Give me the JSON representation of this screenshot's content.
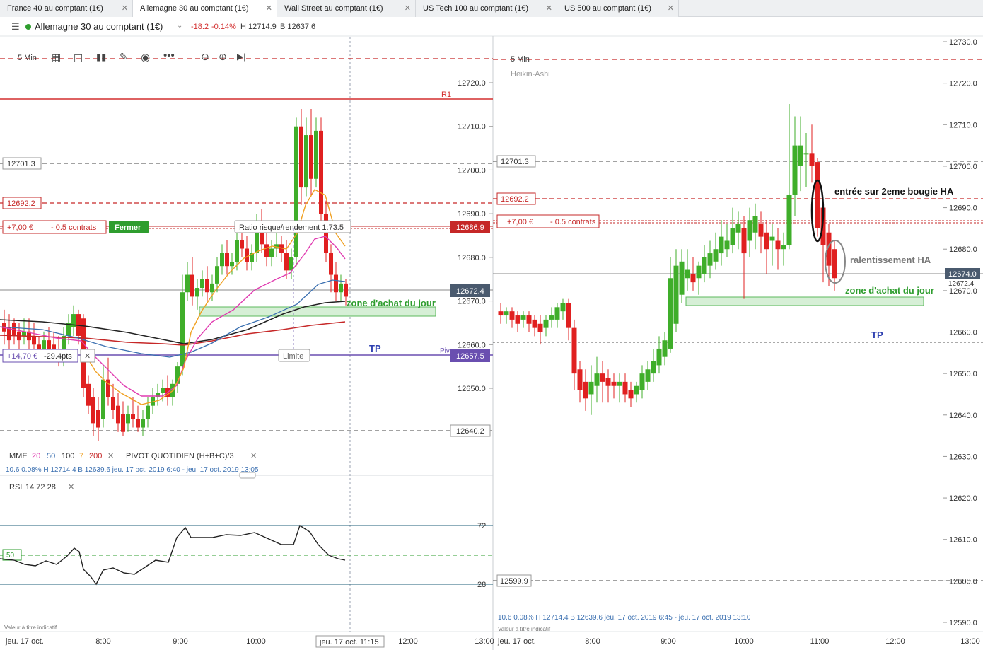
{
  "tabs": [
    {
      "label": "France 40 au comptant (1€)"
    },
    {
      "label": "Allemagne 30 au comptant (1€)"
    },
    {
      "label": "Wall Street au comptant (1€)"
    },
    {
      "label": "US Tech 100 au comptant (1€)"
    },
    {
      "label": "US 500 au comptant (1€)"
    }
  ],
  "active_tab": 1,
  "header": {
    "instrument": "Allemagne 30 au comptant (1€)",
    "change": "-18.2",
    "change_pct": "-0.14%",
    "high": "H 12714.9",
    "low": "B 12637.6"
  },
  "left_chart": {
    "timeframe": "5 Min",
    "price_axis": [
      "12720.0",
      "12710.0",
      "12700.0",
      "12690.0",
      "12680.0",
      "12670.0",
      "12660.0",
      "12650.0"
    ],
    "time_axis": [
      "8:00",
      "9:00",
      "10:00",
      "12:00",
      "13:00"
    ],
    "date_start": "jeu. 17 oct.",
    "crosshair_time": "jeu. 17 oct. 11:15",
    "level_labels": {
      "l12701": "12701.3",
      "l12692": "12692.2",
      "l12640": "12640.2"
    },
    "r1_label": "R1",
    "pivot_label": "Piv",
    "position": {
      "pnl": "+7,00 €",
      "size": "- 0.5 contrats",
      "close_button": "Fermer"
    },
    "ratio_label": "Ratio risque/rendement 1:73.5",
    "target": {
      "pnl": "+14,70 €",
      "pts": "-29.4pts"
    },
    "limit_label": "Limite",
    "badges": {
      "entry": "12686.9",
      "current": "12672.4",
      "limit": "12657.5"
    },
    "indicators": {
      "mme_label": "MME",
      "mme_periods": [
        "20",
        "50",
        "100",
        "7",
        "200"
      ],
      "pivot_label": "PIVOT QUOTIDIEN (H+B+C)/3",
      "stats": "10.6   0.08%   H 12714.4   B 12639.6   jeu. 17 oct. 2019 6:40 - jeu. 17 oct. 2019 13:05"
    },
    "rsi": {
      "label": "RSI",
      "params": [
        "14",
        "72",
        "28"
      ],
      "levels": [
        "72",
        "50",
        "28"
      ]
    },
    "disclaimer": "Valeur à titre indicatif"
  },
  "right_chart": {
    "timeframe": "5 Min",
    "subtitle": "Heikin-Ashi",
    "price_axis": [
      "12730.0",
      "12720.0",
      "12710.0",
      "12700.0",
      "12690.0",
      "12680.0",
      "12670.0",
      "12660.0",
      "12650.0",
      "12640.0",
      "12630.0",
      "12620.0",
      "12610.0",
      "12600.0",
      "12590.0"
    ],
    "time_axis": [
      "8:00",
      "9:00",
      "10:00",
      "11:00",
      "12:00",
      "13:00"
    ],
    "date_start": "jeu. 17 oct.",
    "level_labels": {
      "l12701": "12701.3",
      "l12692": "12692.2",
      "l12599": "12599.9"
    },
    "position": {
      "pnl": "+7,00 €",
      "size": "- 0.5 contrats"
    },
    "badges": {
      "current": "12674.0",
      "current_under": "12672.4"
    },
    "stats": "10.6   0.08%   H 12714.4   B 12639.6   jeu. 17 oct. 2019 6:45 - jeu. 17 oct. 2019 13:10",
    "disclaimer": "Valeur à titre indicatif"
  },
  "annotations": {
    "zone_left": "zone d'achat du jour",
    "tp_left": "TP",
    "entry_note": "entrée sur 2eme bougie HA",
    "slow_note": "ralentissement HA",
    "zone_right": "zone d'achat du jour",
    "tp_right": "TP"
  },
  "colors": {
    "up": "#3fae2a",
    "down": "#e02020",
    "pivot": "#6a4fb0",
    "badge_red": "#c62828",
    "badge_dark": "#4a5a6e",
    "accent_green": "#2e9d2e",
    "tp_blue": "#2d3fb0"
  }
}
